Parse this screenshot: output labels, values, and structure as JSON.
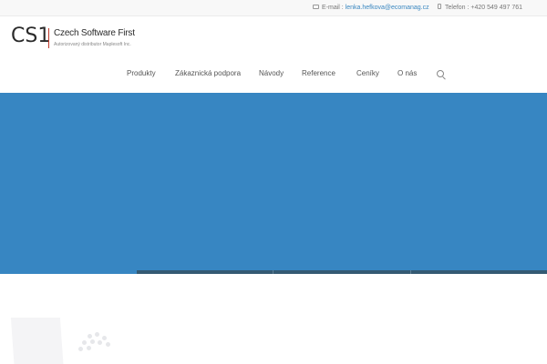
{
  "topbar": {
    "email_label": "E-mail :",
    "email_value": "lenka.hefkova@ecomanag.cz",
    "phone_label": "Telefon :",
    "phone_value": "+420 549 497 761"
  },
  "logo": {
    "mark": "CS1",
    "title": "Czech Software First",
    "subtitle": "Autorizovaný distributor Maplesoft Inc."
  },
  "nav": {
    "items": [
      {
        "label": "Produkty"
      },
      {
        "label": "Zákaznická podpora"
      },
      {
        "label": "Návody"
      },
      {
        "label": "Reference"
      },
      {
        "label": "Ceníky"
      },
      {
        "label": "O nás"
      }
    ]
  },
  "colors": {
    "hero": "#3786c2",
    "strip": "#345a73",
    "logo_accent": "#c0392b",
    "link": "#3a87c0"
  }
}
